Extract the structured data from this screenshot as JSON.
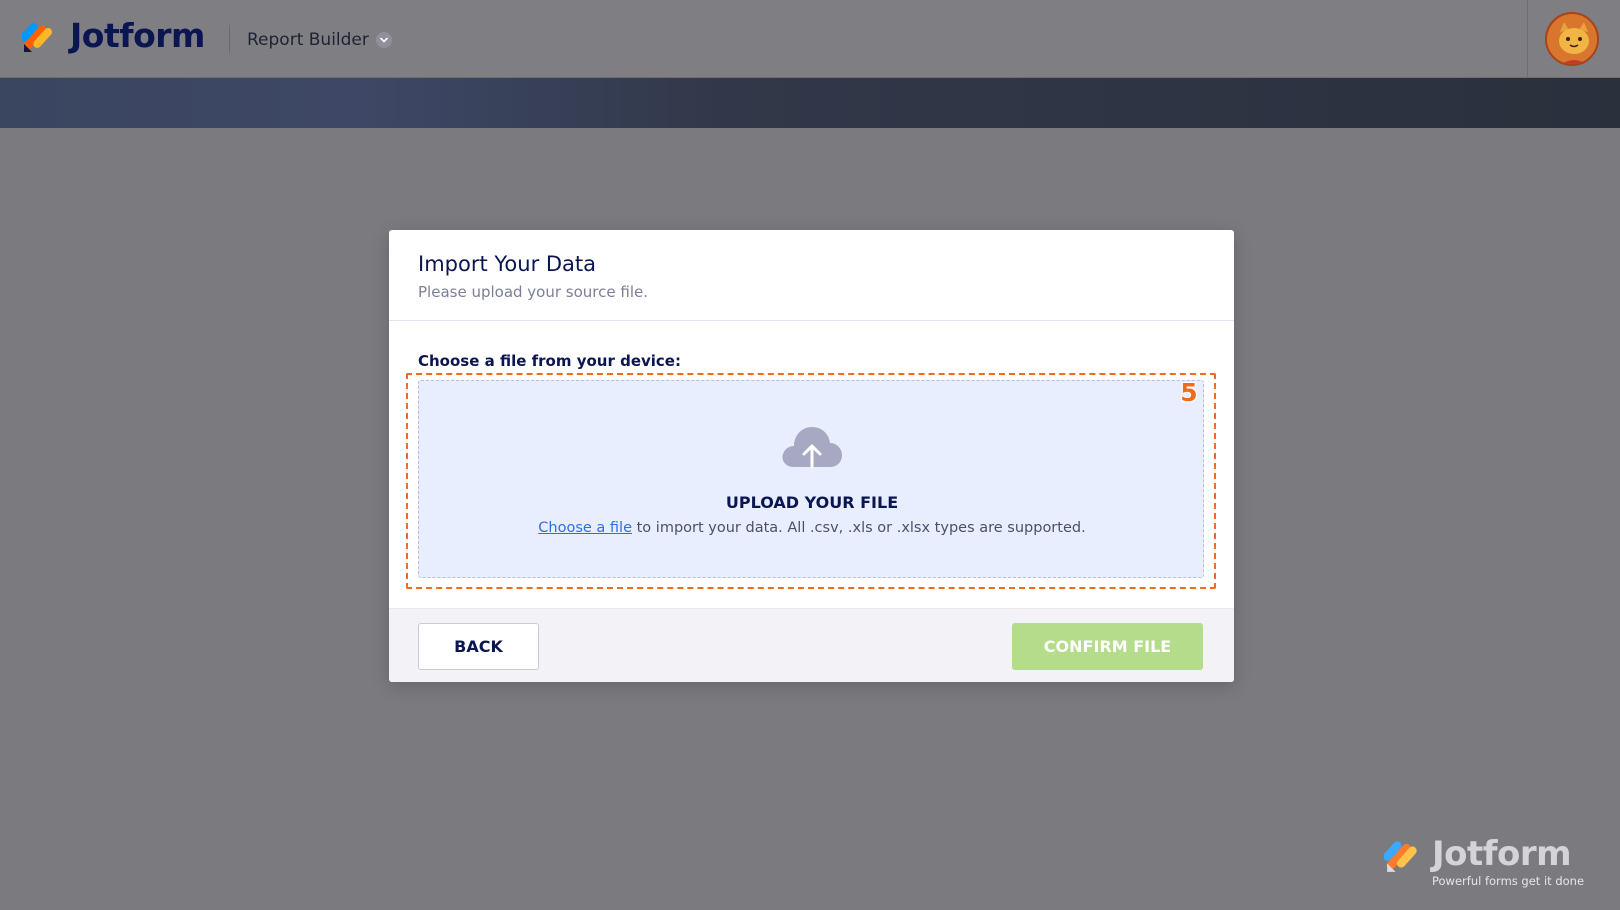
{
  "header": {
    "brand": "Jotform",
    "product": "Report Builder"
  },
  "modal": {
    "title": "Import Your Data",
    "subtitle": "Please upload your source file.",
    "choose_label": "Choose a file from your device:",
    "upload_title": "UPLOAD YOUR FILE",
    "choose_link": "Choose a file",
    "upload_desc": " to import your data. All .csv, .xls or .xlsx types are supported.",
    "step_number": "5",
    "back_label": "BACK",
    "confirm_label": "CONFIRM FILE"
  },
  "watermark": {
    "brand": "Jotform",
    "tagline": "Powerful forms get it done"
  },
  "colors": {
    "brand_navy": "#0a1551",
    "highlight_orange": "#f26a1b",
    "confirm_green": "#b4dc8a",
    "dropzone_bg": "#e8eefe",
    "link_blue": "#2f6fe8"
  },
  "icons": {
    "logo": "jotform-logo-icon",
    "chevron": "chevron-down-icon",
    "avatar": "user-avatar",
    "upload": "cloud-upload-icon"
  }
}
